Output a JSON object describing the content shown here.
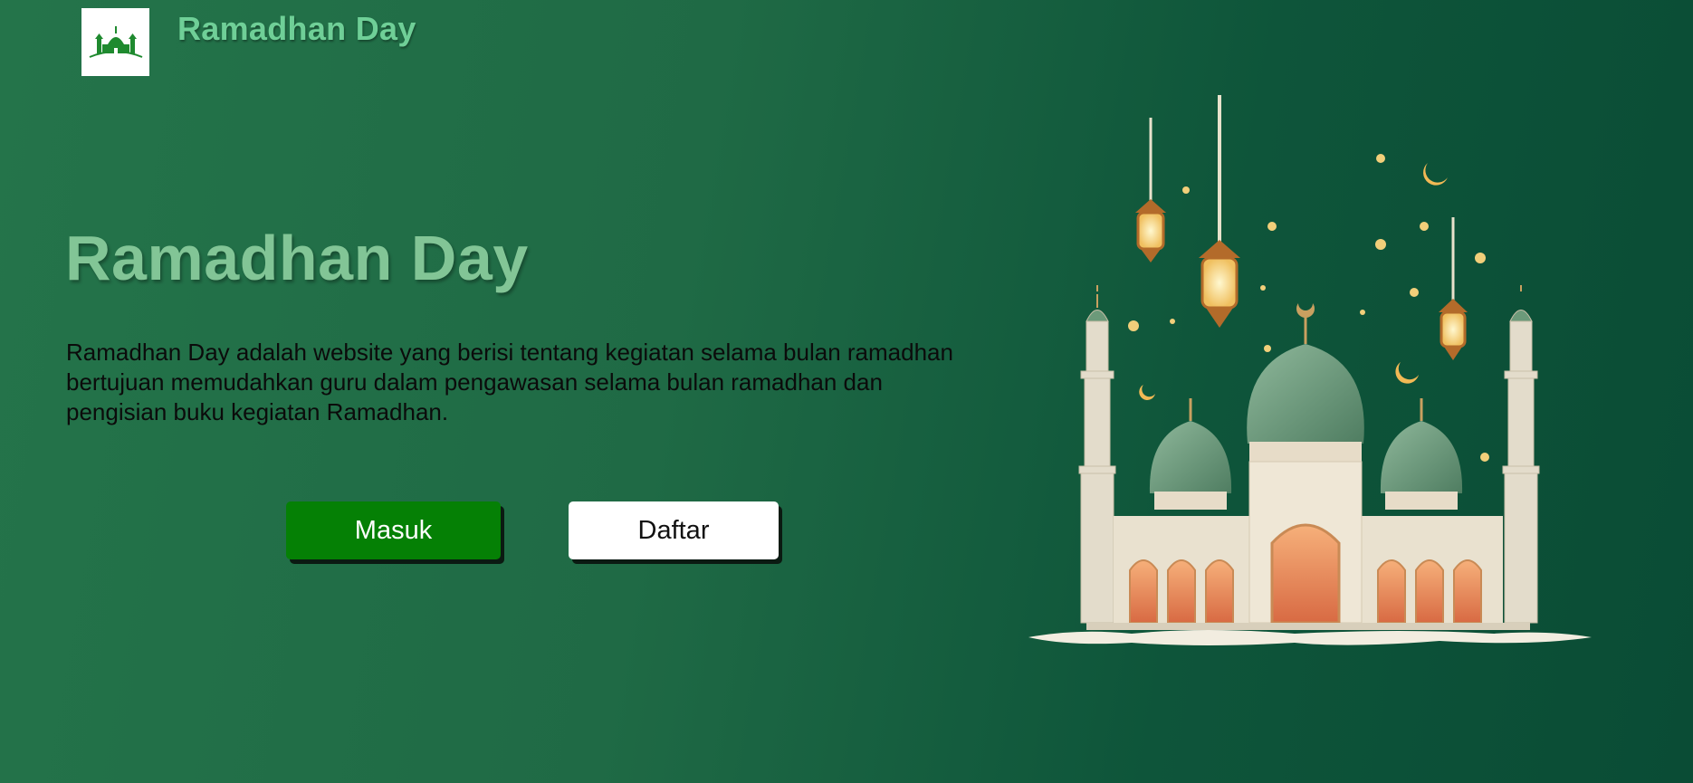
{
  "header": {
    "brand": "Ramadhan Day",
    "logo_icon": "mosque-logo-icon"
  },
  "hero": {
    "title": "Ramadhan Day",
    "description": "Ramadhan Day adalah website yang berisi tentang kegiatan selama bulan ramadhan bertujuan memudahkan guru dalam pengawasan selama bulan ramadhan dan pengisian buku kegiatan Ramadhan."
  },
  "buttons": {
    "login_label": "Masuk",
    "register_label": "Daftar"
  },
  "colors": {
    "background_start": "#24744a",
    "background_end": "#0a4c35",
    "brand_text": "#6fcf97",
    "title_text": "#82c596",
    "login_button": "#058005",
    "register_button": "#ffffff"
  },
  "illustration": {
    "icon": "mosque-illustration"
  }
}
